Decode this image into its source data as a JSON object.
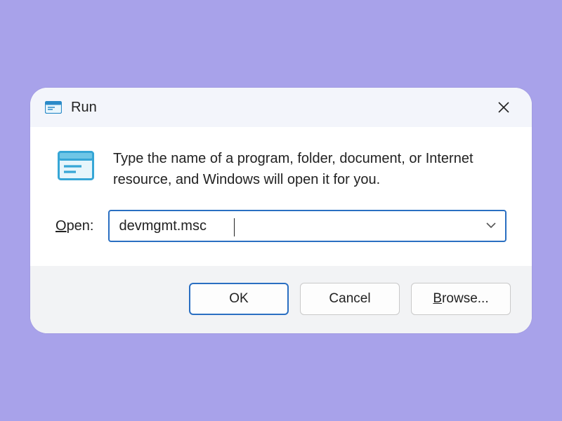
{
  "titlebar": {
    "title": "Run"
  },
  "body": {
    "description": "Type the name of a program, folder, document, or Internet resource, and Windows will open it for you.",
    "open_label": "Open:",
    "command_value": "devmgmt.msc"
  },
  "buttons": {
    "ok": "OK",
    "cancel": "Cancel",
    "browse": "Browse..."
  }
}
